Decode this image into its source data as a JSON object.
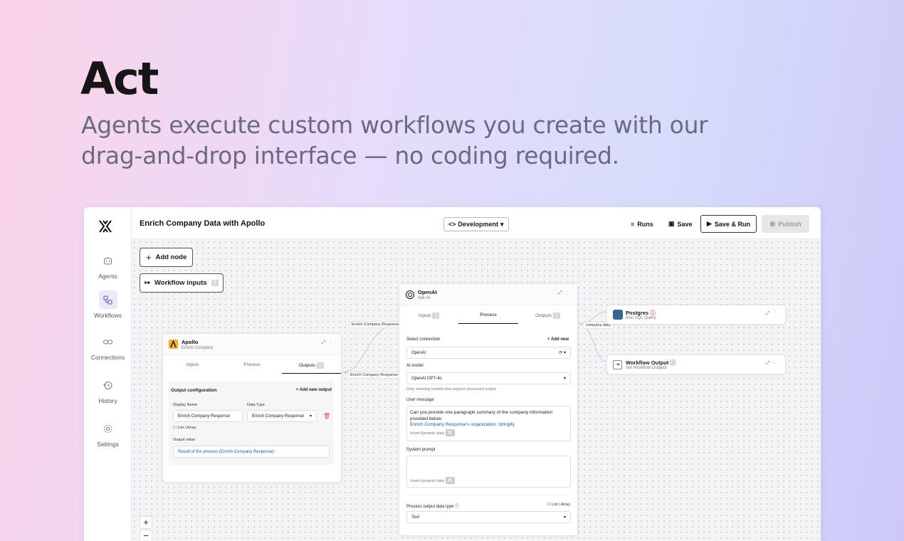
{
  "hero": {
    "title": "Act",
    "subtitle": "Agents execute custom workflows you create with our drag-and-drop interface — no coding required."
  },
  "sidebar": {
    "items": [
      {
        "label": "Agents",
        "icon": "bot-icon"
      },
      {
        "label": "Workflows",
        "icon": "workflow-icon",
        "active": true
      },
      {
        "label": "Connections",
        "icon": "link-icon"
      },
      {
        "label": "History",
        "icon": "history-icon"
      },
      {
        "label": "Settings",
        "icon": "gear-icon"
      }
    ]
  },
  "topbar": {
    "title": "Enrich Company Data with Apollo",
    "env": "Development",
    "runs": "Runs",
    "save": "Save",
    "save_run": "Save & Run",
    "publish": "Publish"
  },
  "canvas": {
    "add_node": "Add node",
    "workflow_inputs": "Workflow inputs",
    "workflow_inputs_count": "1"
  },
  "apollo": {
    "title": "Apollo",
    "subtitle": "Enrich Company",
    "tabs": [
      "Inputs",
      "Process",
      "Outputs"
    ],
    "outputs_count": "1",
    "section": "Output configuration",
    "add_output": "Add new output",
    "display_name_label": "Display Name",
    "display_name": "Enrich Company Response",
    "data_type_label": "Data Type",
    "data_type": "Enrich Company Response",
    "list_array": "List / Array",
    "output_value_label": "Output value",
    "output_value": "Result of the process (Enrich Company Response)"
  },
  "edges": {
    "label1": "Enrich Company Response",
    "label2": "Enrich Company Response",
    "label3": "company data"
  },
  "openai": {
    "title": "OpenAI",
    "subtitle": "Ask AI",
    "tabs": [
      "Inputs",
      "Process",
      "Outputs"
    ],
    "inputs_count": "1",
    "outputs_count": "1",
    "select_connection": "Select connection",
    "add_new": "Add new",
    "connection": "OpenAI",
    "ai_model_label": "AI model",
    "ai_model": "OpenAI GPT-4o",
    "model_note": "Only showing models that support structured output",
    "user_message_label": "User message",
    "user_message": "Can you provide one paragraph summary of the company information provided below:",
    "user_message_var": "Enrich Company Response's organization :stringify",
    "insert_dynamic": "Insert dynamic data",
    "system_prompt_label": "System prompt",
    "output_type_label": "Process output data type",
    "list_array": "List / Array",
    "output_type": "Text"
  },
  "postgres": {
    "title": "Postgres",
    "subtitle": "Run SQL Query"
  },
  "wf_output": {
    "title": "Workflow Output",
    "subtitle": "Set Workflow Outputs"
  },
  "zoom": {
    "plus": "+",
    "minus": "−"
  },
  "colors": {
    "accent": "#5b4fd6",
    "apollo": "#f5b323",
    "postgres": "#336791",
    "warn": "#e5484d"
  }
}
